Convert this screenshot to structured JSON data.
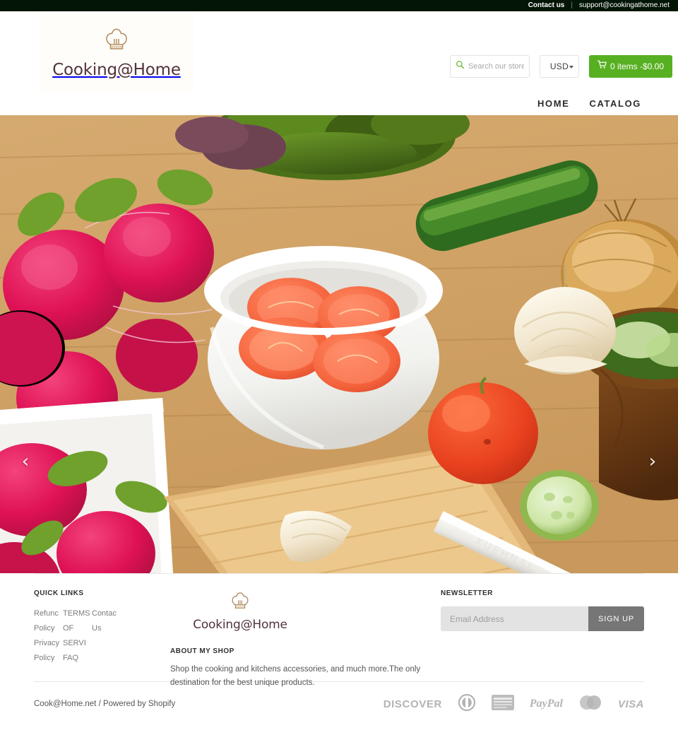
{
  "topbar": {
    "contact_label": "Contact us",
    "separator": "|",
    "email": "support@cookingathome.net"
  },
  "header": {
    "logo_text": "Cooking@Home",
    "logo_icon": "chef-hat-icon",
    "search": {
      "icon": "search-icon",
      "placeholder": "Search our store",
      "value": ""
    },
    "currency": {
      "selected": "USD",
      "options": [
        "USD"
      ],
      "icon": "chevron-down-icon"
    },
    "cart": {
      "icon": "shopping-cart-icon",
      "label": "0 items -$0.00",
      "color": "#57b022"
    }
  },
  "nav": {
    "items": [
      {
        "label": "HOME"
      },
      {
        "label": "CATALOG"
      }
    ]
  },
  "hero": {
    "prev_icon": "chevron-left-icon",
    "next_icon": "chevron-right-icon",
    "alt": "fresh vegetables on a wooden cutting board - radishes, sliced tomatoes in a white bowl, onion, cucumber and a knife"
  },
  "footer": {
    "quick_links": {
      "heading": "QUICK LINKS",
      "columns": [
        {
          "items": [
            "Refunc",
            "Policy",
            "Privacy",
            "Policy"
          ]
        },
        {
          "items": [
            "TERMS",
            "OF",
            "SERVI",
            "FAQ"
          ]
        },
        {
          "items": [
            "Contac",
            "Us"
          ]
        }
      ]
    },
    "logo_text": "Cooking@Home",
    "about": {
      "heading": "ABOUT MY SHOP",
      "text": "Shop the cooking and kitchens accessories, and much more.The only destination for the best unique products."
    },
    "newsletter": {
      "heading": "NEWSLETTER",
      "placeholder": "Email Address",
      "value": "",
      "button_label": "SIGN UP"
    },
    "copyright": "Cook@Home.net / Powered by Shopify",
    "payments": [
      {
        "name": "discover-card-icon",
        "label": "DISCOVER"
      },
      {
        "name": "diners-club-card-icon",
        "label": ""
      },
      {
        "name": "american-express-card-icon",
        "label": ""
      },
      {
        "name": "paypal-icon",
        "label": "PayPal"
      },
      {
        "name": "mastercard-icon",
        "label": ""
      },
      {
        "name": "visa-card-icon",
        "label": "VISA"
      }
    ]
  }
}
